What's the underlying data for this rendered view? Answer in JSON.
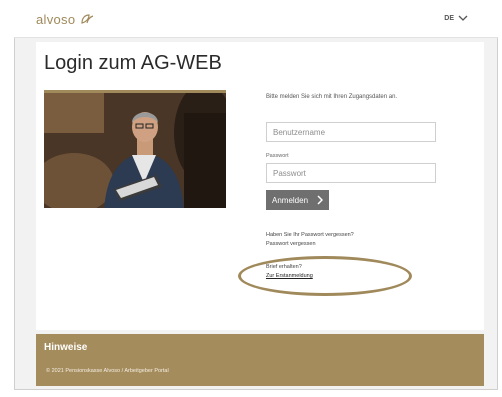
{
  "header": {
    "logo_text": "alvoso",
    "language": "DE"
  },
  "main": {
    "title": "Login zum AG-WEB",
    "intro": "Bitte melden Sie sich mit Ihren Zugangsdaten an.",
    "username": {
      "value": "",
      "placeholder": "Benutzername"
    },
    "password": {
      "label": "Passwort",
      "value": "",
      "placeholder": "Passwort"
    },
    "login_button": "Anmelden",
    "forgot_question": "Haben Sie Ihr Passwort vergessen?",
    "forgot_link": "Passwort vergessen",
    "letter_question": "Brief erhalten?",
    "first_login_link": "Zur Erstanmeldung"
  },
  "footer": {
    "title": "Hinweise",
    "copyright": "© 2021 Pensionskasse Alvoso / Arbeitgeber Portal"
  },
  "colors": {
    "brand_gold": "#a58c5c",
    "button_gray": "#6f6f6f",
    "annotation_oval": "#a0895a"
  }
}
